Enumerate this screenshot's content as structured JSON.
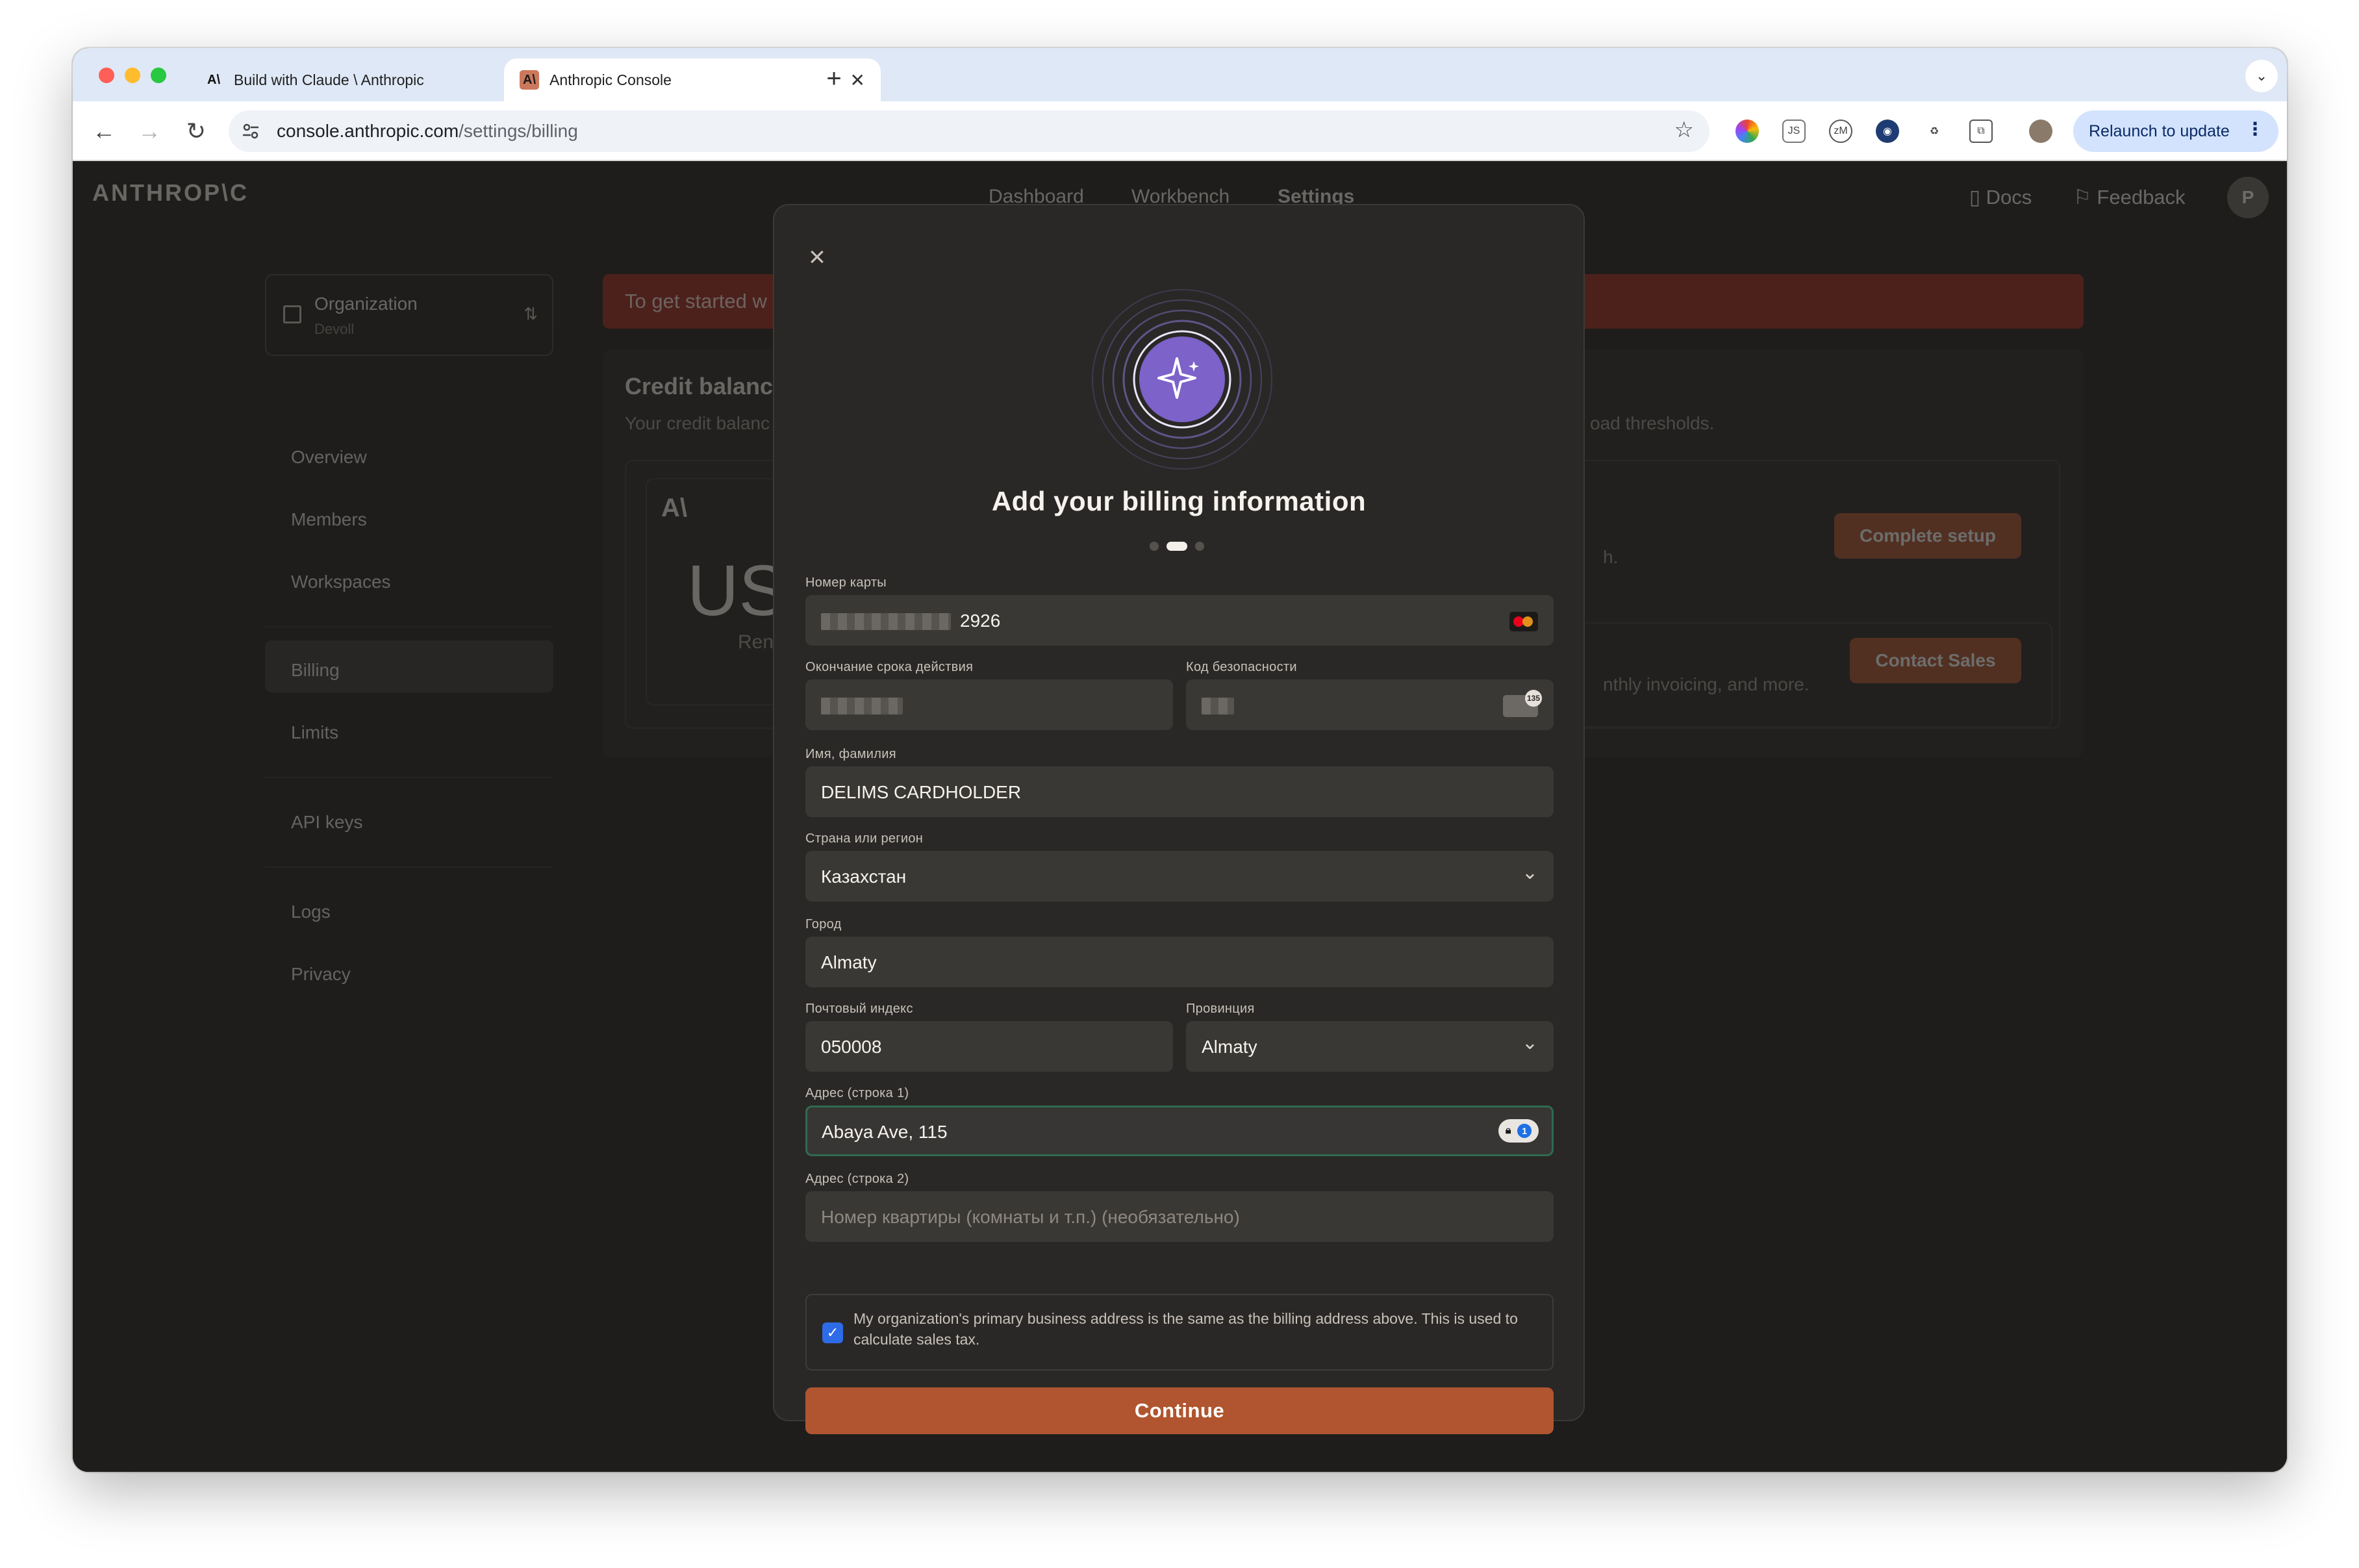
{
  "browser": {
    "tabs": [
      {
        "title": "Build with Claude \\ Anthropic",
        "favicon": "A\\",
        "active": false
      },
      {
        "title": "Anthropic Console",
        "favicon": "A\\",
        "active": true
      }
    ],
    "new_tab": "+",
    "tab_menu": "⌄",
    "url_host": "console.anthropic.com",
    "url_path": "/settings/billing",
    "relaunch_label": "Relaunch to update",
    "extensions": [
      "color-wheel-icon",
      "js-icon",
      "zm-icon",
      "github-icon",
      "recycle-icon",
      "puzzle-icon",
      "profile-avatar-icon"
    ]
  },
  "header": {
    "logo": "ANTHROP\\C",
    "nav": [
      "Dashboard",
      "Workbench",
      "Settings"
    ],
    "docs": "Docs",
    "feedback": "Feedback",
    "avatar_initial": "P"
  },
  "sidebar": {
    "org_label": "Organization",
    "org_name": "Devoll",
    "items": [
      "Overview",
      "Members",
      "Workspaces",
      "Billing",
      "Limits",
      "API keys",
      "Logs",
      "Privacy"
    ],
    "active": "Billing"
  },
  "background": {
    "banner": "To get started w",
    "credit_title": "Credit balanc",
    "credit_desc": "Your credit balanc",
    "credit_desc_tail": "oad thresholds.",
    "balance_prefix": "US",
    "remaining_prefix": "Ren",
    "line1_tail": "h.",
    "line2_tail": "nthly invoicing, and more.",
    "complete_setup": "Complete setup",
    "contact_sales": "Contact Sales"
  },
  "modal": {
    "title": "Add your billing information",
    "steps": 3,
    "active_step": 2,
    "card_number_label": "Номер карты",
    "card_number_tail": "2926",
    "expiry_label": "Окончание срока действия",
    "cvc_label": "Код безопасности",
    "cvc_badge": "135",
    "name_label": "Имя, фамилия",
    "name_value": "DELIMS CARDHOLDER",
    "country_label": "Страна или регион",
    "country_value": "Казахстан",
    "city_label": "Город",
    "city_value": "Almaty",
    "postal_label": "Почтовый индекс",
    "postal_value": "050008",
    "province_label": "Провинция",
    "province_value": "Almaty",
    "address1_label": "Адрес (строка 1)",
    "address1_value": "Abaya Ave, 115",
    "address2_label": "Адрес (строка 2)",
    "address2_placeholder": "Номер квартиры (комнаты и т.п.) (необязательно)",
    "consent_checked": true,
    "consent_text": "My organization's primary business address is the same as the billing address above. This is used to calculate sales tax.",
    "continue_label": "Continue"
  },
  "colors": {
    "accent": "#b0552f",
    "hero_purple": "#7c62c9",
    "checkbox_blue": "#2e6be6",
    "focus_green": "#2f6b52",
    "banner_red": "#a32a1e"
  }
}
